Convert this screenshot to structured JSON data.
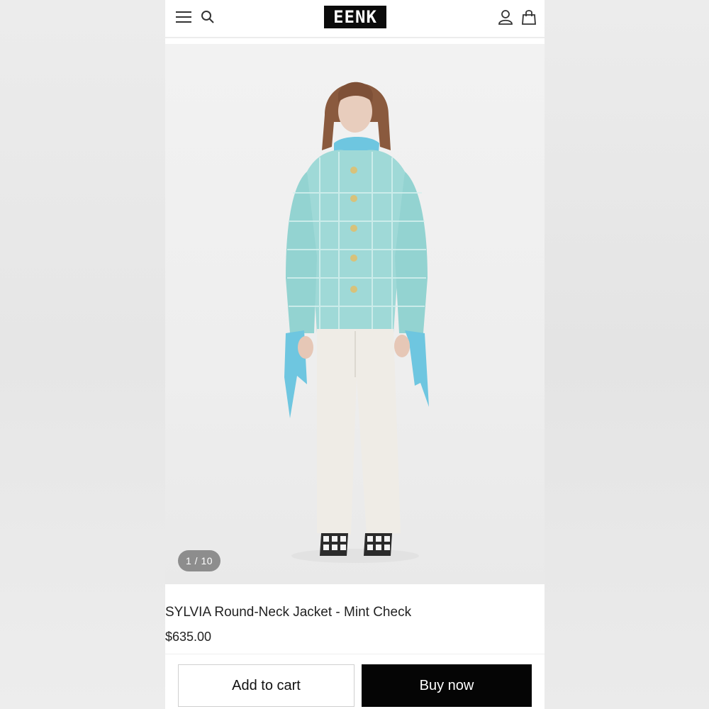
{
  "header": {
    "logo_text": "EENK",
    "icons": {
      "menu": "hamburger-menu-icon",
      "search": "search-icon",
      "account": "user-icon",
      "cart": "shopping-bag-icon"
    }
  },
  "gallery": {
    "counter": "1 / 10"
  },
  "product": {
    "title": "SYLVIA Round-Neck Jacket - Mint Check",
    "price": "$635.00"
  },
  "actions": {
    "add_to_cart": "Add to cart",
    "buy_now": "Buy now"
  },
  "colors": {
    "accent_button": "#050505",
    "jacket": "#9fd9d7",
    "scarf": "#6ec6e0",
    "trousers": "#efece6"
  }
}
